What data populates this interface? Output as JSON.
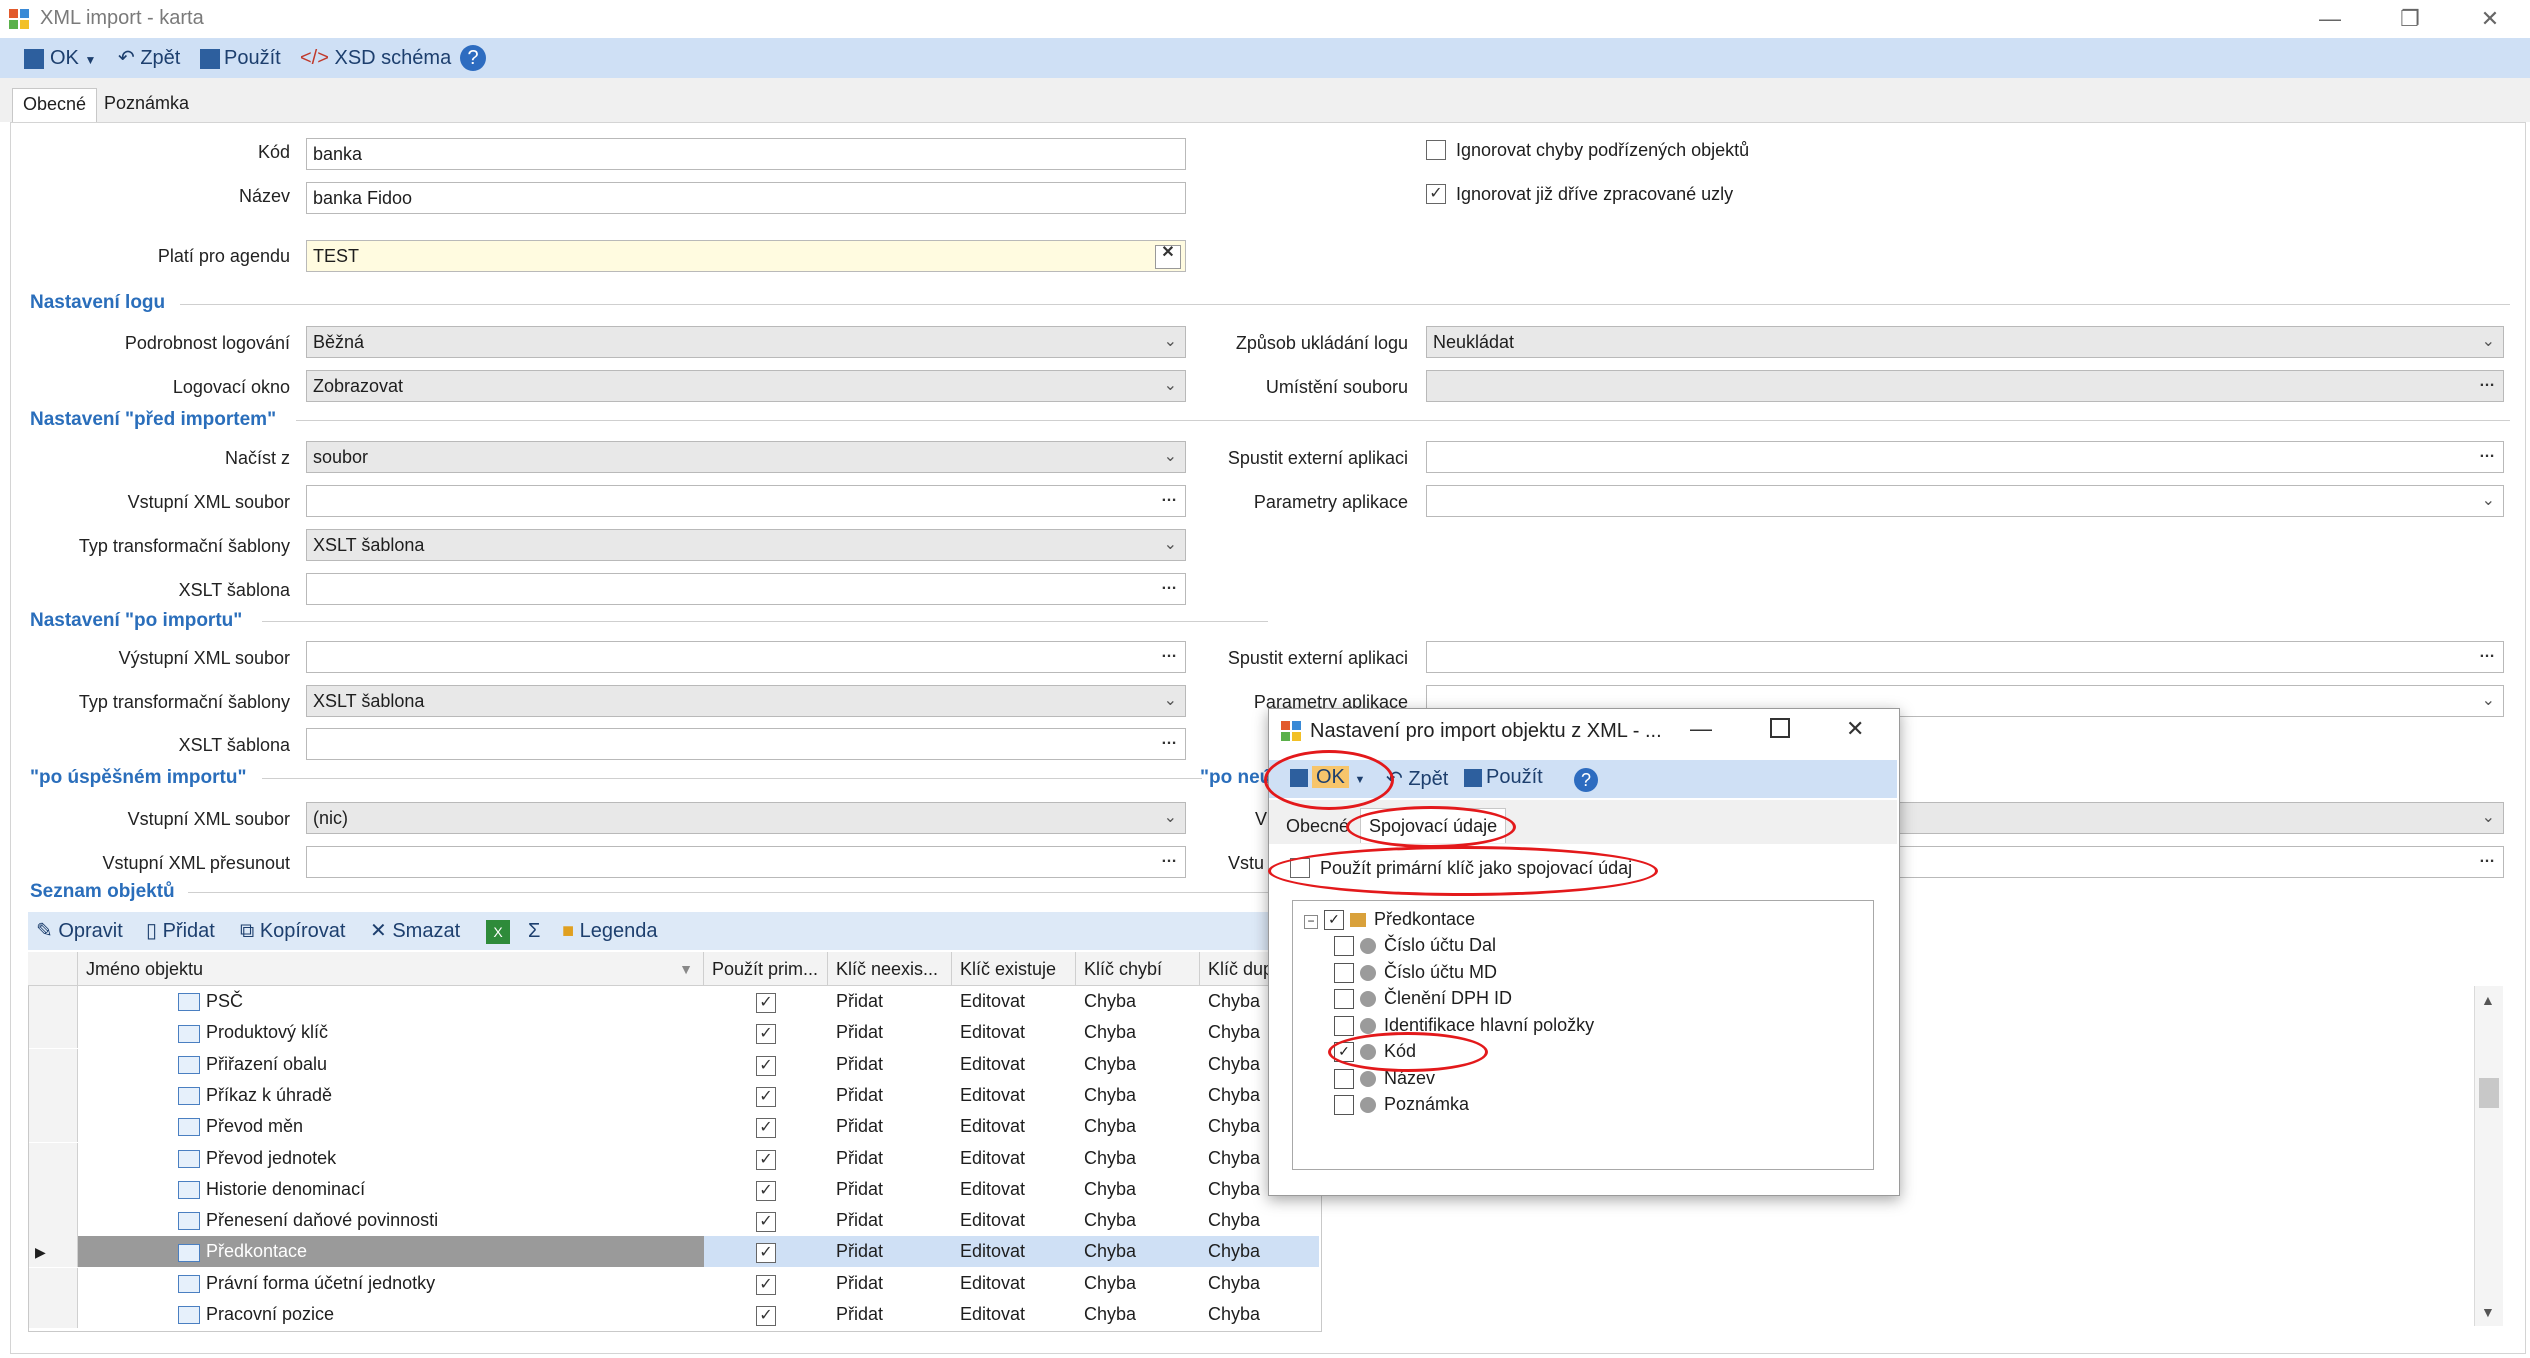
{
  "window": {
    "title": "XML import - karta",
    "minimize": "—",
    "restore": "❐",
    "close": "✕"
  },
  "toolbar": {
    "ok": "OK",
    "back": "Zpět",
    "apply": "Použít",
    "xsd": "XSD schéma",
    "help": "?"
  },
  "tabs": [
    "Obecné",
    "Poznámka"
  ],
  "general": {
    "kod_label": "Kód",
    "kod_value": "banka",
    "nazev_label": "Název",
    "nazev_value": "banka Fidoo",
    "agenda_label": "Platí pro agendu",
    "agenda_value": "TEST",
    "ignore_errors": "Ignorovat chyby podřízených objektů",
    "ignore_processed": "Ignorovat již dříve zpracované uzly"
  },
  "log": {
    "section": "Nastavení logu",
    "detail_label": "Podrobnost logování",
    "detail_value": "Běžná",
    "window_label": "Logovací okno",
    "window_value": "Zobrazovat",
    "save_label": "Způsob ukládání logu",
    "save_value": "Neukládat",
    "file_label": "Umístění souboru"
  },
  "before": {
    "section": "Nastavení \"před importem\"",
    "load_label": "Načíst z",
    "load_value": "soubor",
    "input_label": "Vstupní XML soubor",
    "type_label": "Typ transformační šablony",
    "type_value": "XSLT šablona",
    "xslt_label": "XSLT šablona",
    "ext_label": "Spustit externí aplikaci",
    "params_label": "Parametry aplikace"
  },
  "after": {
    "section": "Nastavení \"po importu\"",
    "output_label": "Výstupní XML soubor",
    "type_label": "Typ transformační šablony",
    "type_value": "XSLT šablona",
    "xslt_label": "XSLT šablona",
    "ext_label": "Spustit externí aplikaci",
    "params_label": "Parametry aplikace"
  },
  "success": {
    "section": "\"po úspěšném importu\"",
    "section_right": "\"po neú",
    "input_label": "Vstupní XML soubor",
    "input_value": "(nic)",
    "move_label": "Vstupní XML přesunout",
    "right_label_1": "V",
    "right_label_2": "Vstu"
  },
  "objects": {
    "section": "Seznam objektů",
    "toolbar": [
      "Opravit",
      "Přidat",
      "Kopírovat",
      "Smazat",
      "Σ",
      "Legenda"
    ],
    "columns": [
      "Jméno objektu",
      "Použít prim...",
      "Klíč neexis...",
      "Klíč existuje",
      "Klíč chybí",
      "Klíč dup"
    ],
    "rows": [
      {
        "name": "PSČ",
        "a": "Přidat",
        "b": "Editovat",
        "c": "Chyba",
        "d": "Chyba"
      },
      {
        "name": "Produktový klíč",
        "a": "Přidat",
        "b": "Editovat",
        "c": "Chyba",
        "d": "Chyba"
      },
      {
        "name": "Přiřazení obalu",
        "a": "Přidat",
        "b": "Editovat",
        "c": "Chyba",
        "d": "Chyba"
      },
      {
        "name": "Příkaz k úhradě",
        "a": "Přidat",
        "b": "Editovat",
        "c": "Chyba",
        "d": "Chyba"
      },
      {
        "name": "Převod měn",
        "a": "Přidat",
        "b": "Editovat",
        "c": "Chyba",
        "d": "Chyba"
      },
      {
        "name": "Převod jednotek",
        "a": "Přidat",
        "b": "Editovat",
        "c": "Chyba",
        "d": "Chyba"
      },
      {
        "name": "Historie denominací",
        "a": "Přidat",
        "b": "Editovat",
        "c": "Chyba",
        "d": "Chyba"
      },
      {
        "name": "Přenesení daňové povinnosti",
        "a": "Přidat",
        "b": "Editovat",
        "c": "Chyba",
        "d": "Chyba"
      },
      {
        "name": "Předkontace",
        "a": "Přidat",
        "b": "Editovat",
        "c": "Chyba",
        "d": "Chyba"
      },
      {
        "name": "Právní forma účetní jednotky",
        "a": "Přidat",
        "b": "Editovat",
        "c": "Chyba",
        "d": "Chyba"
      },
      {
        "name": "Pracovní pozice",
        "a": "Přidat",
        "b": "Editovat",
        "c": "Chyba",
        "d": "Chyba"
      }
    ]
  },
  "dialog": {
    "title": "Nastavení pro import objektu z XML - ...",
    "ok": "OK",
    "back": "Zpět",
    "apply": "Použít",
    "tab_general": "Obecné",
    "tab_join": "Spojovací údaje",
    "use_primary": "Použít primární klíč jako spojovací údaj",
    "tree_root": "Předkontace",
    "tree_items": [
      {
        "label": "Číslo účtu Dal",
        "checked": false
      },
      {
        "label": "Číslo účtu MD",
        "checked": false
      },
      {
        "label": "Členění DPH ID",
        "checked": false
      },
      {
        "label": "Identifikace hlavní položky",
        "checked": false
      },
      {
        "label": "Kód",
        "checked": true
      },
      {
        "label": "Název",
        "checked": false
      },
      {
        "label": "Poznámka",
        "checked": false
      }
    ]
  },
  "colors": {
    "toolbar": "#cfe0f5",
    "section": "#2a6ebb",
    "highlight": "#e3191b",
    "selected_row": "#9a9a9a"
  }
}
